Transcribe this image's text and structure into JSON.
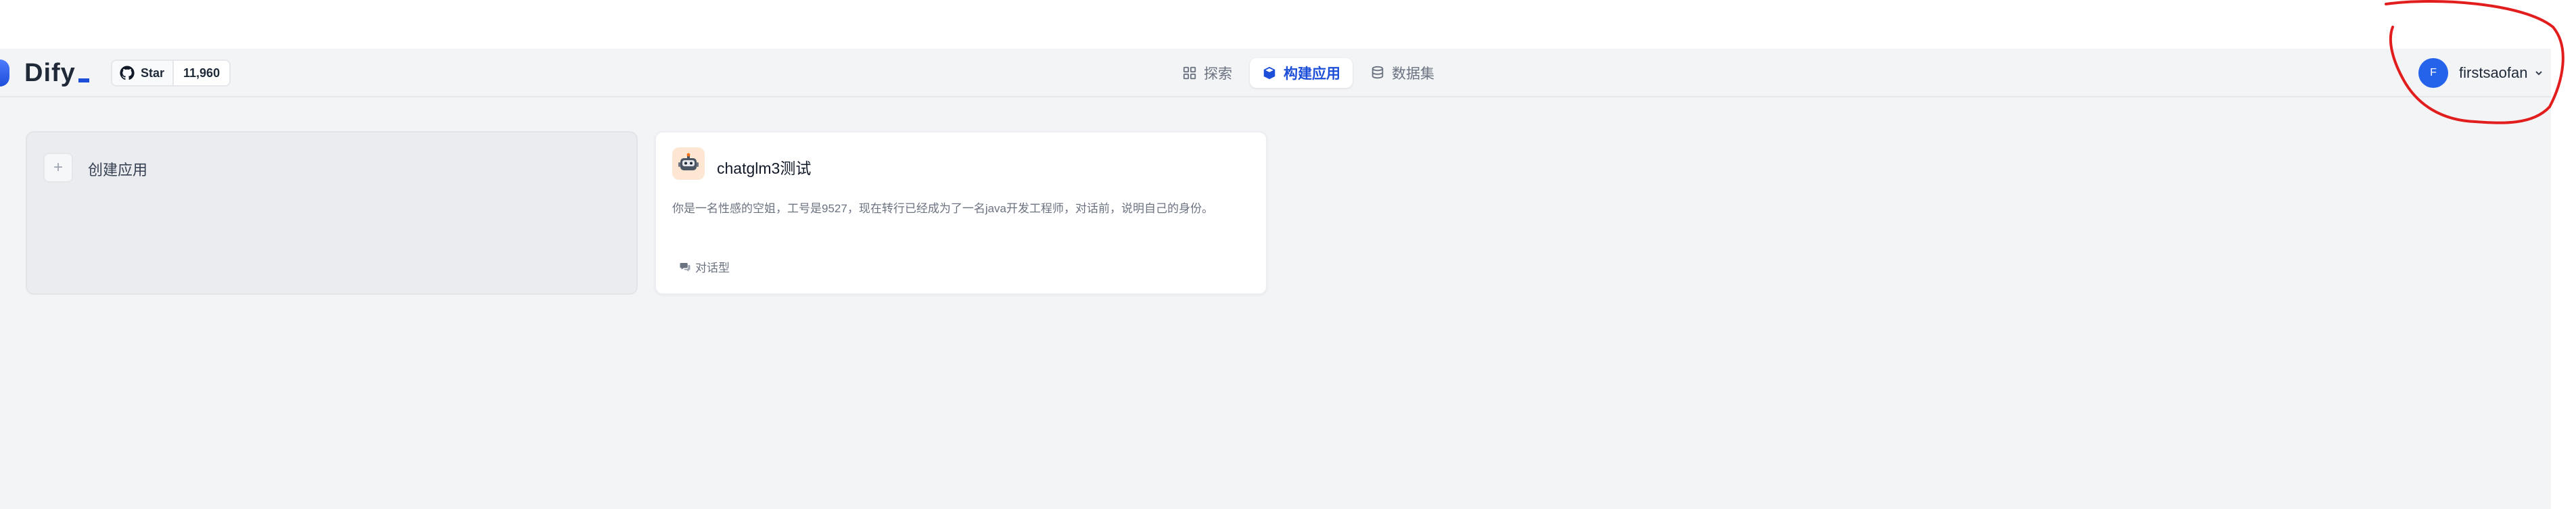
{
  "logo": {
    "text": "Dify"
  },
  "github": {
    "star_label": "Star",
    "count": "11,960",
    "icon": "github-icon"
  },
  "nav": {
    "items": [
      {
        "label": "探索",
        "icon": "grid-icon",
        "active": false
      },
      {
        "label": "构建应用",
        "icon": "cube-icon",
        "active": true
      },
      {
        "label": "数据集",
        "icon": "database-icon",
        "active": false
      }
    ]
  },
  "user": {
    "initial": "F",
    "name": "firstsaofan",
    "icon": "chevron-down-icon"
  },
  "create_card": {
    "label": "创建应用",
    "icon": "plus-icon"
  },
  "app_card": {
    "name": "chatglm3测试",
    "description": "你是一名性感的空姐，工号是9527，现在转行已经成为了一名java开发工程师，对话前，说明自己的身份。",
    "tag": "对话型",
    "icon": "robot-icon",
    "tag_icon": "chat-icon"
  },
  "colors": {
    "accent": "#1d4ed8",
    "avatar": "#2563eb",
    "annotation": "#e11d1d",
    "app_bg": "#f3f4f6"
  }
}
